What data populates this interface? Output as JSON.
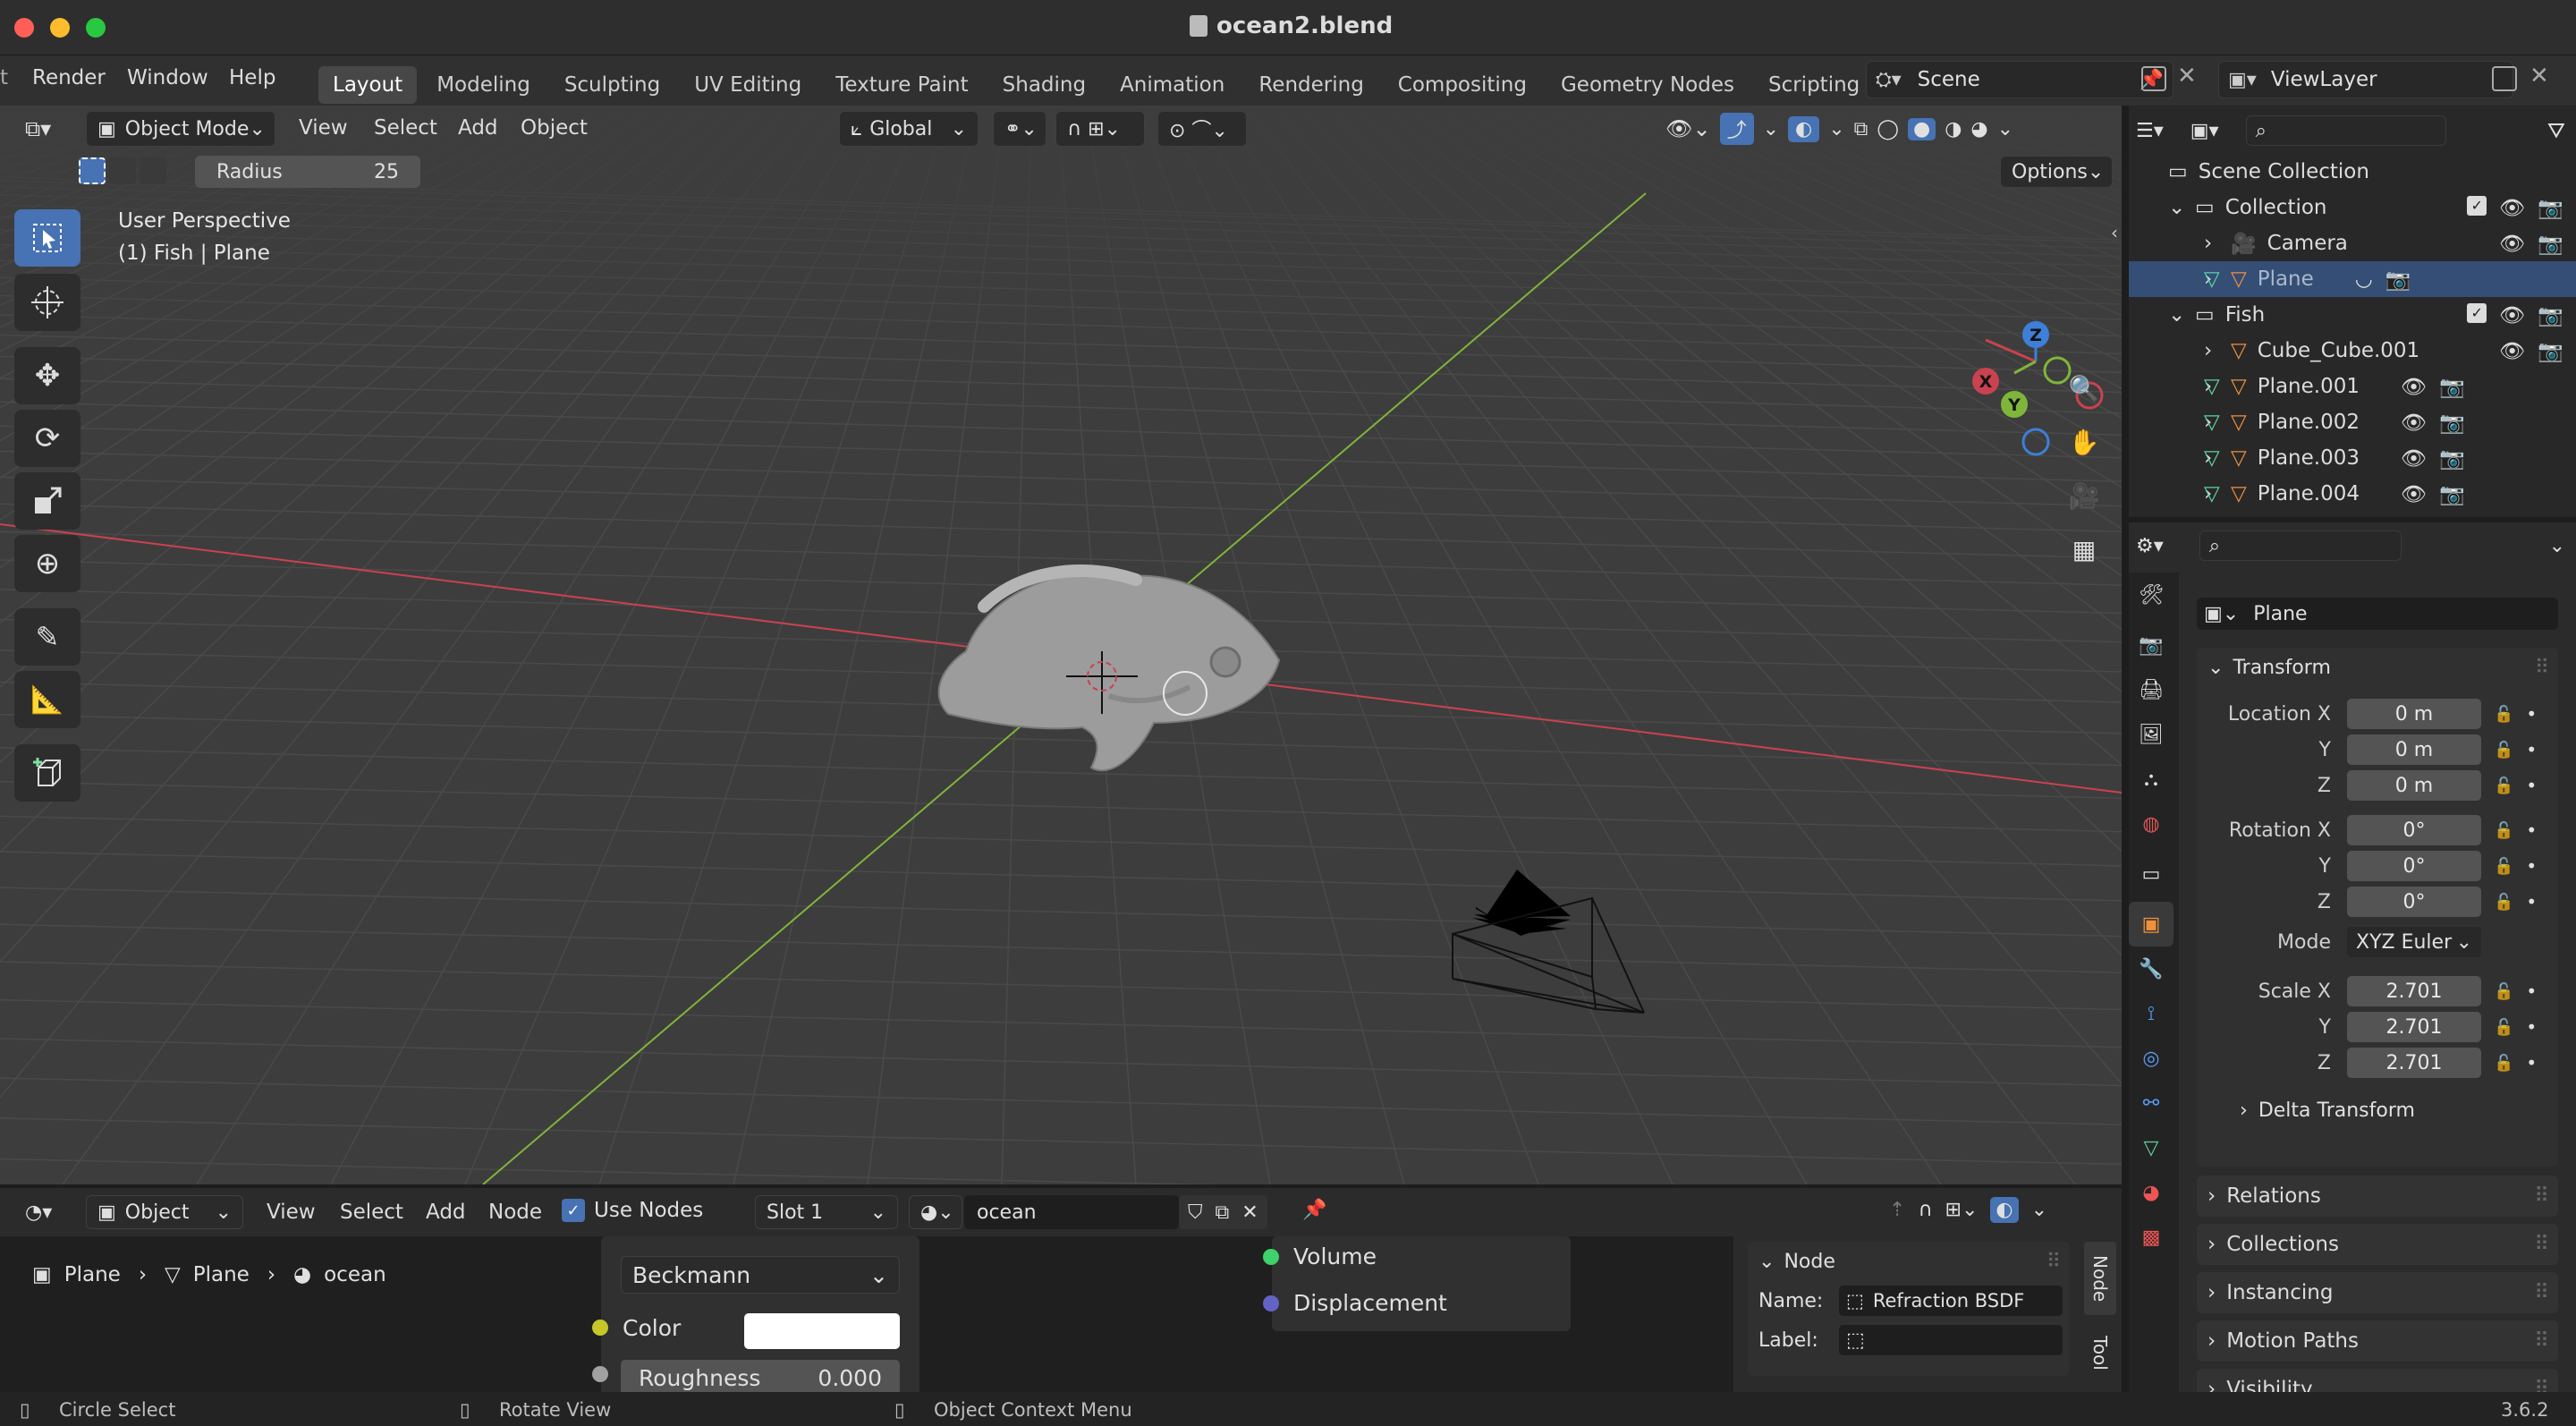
{
  "window": {
    "title": "ocean2.blend"
  },
  "menu": {
    "items": [
      "Render",
      "Window",
      "Help"
    ]
  },
  "workspaces": [
    "Layout",
    "Modeling",
    "Sculpting",
    "UV Editing",
    "Texture Paint",
    "Shading",
    "Animation",
    "Rendering",
    "Compositing",
    "Geometry Nodes",
    "Scripting"
  ],
  "scene": {
    "name": "Scene",
    "view_layer": "ViewLayer"
  },
  "viewport": {
    "mode": "Object Mode",
    "menus": [
      "View",
      "Select",
      "Add",
      "Object"
    ],
    "transform_orientation": "Global",
    "radius_label": "Radius",
    "radius_value": "25",
    "options_label": "Options",
    "overlay_title": "User Perspective",
    "overlay_subtitle": "(1) Fish | Plane",
    "gizmo": {
      "x": "X",
      "y": "Y",
      "z": "Z"
    }
  },
  "outliner": {
    "root": "Scene Collection",
    "rows": [
      {
        "label": "Collection",
        "depth": 1,
        "type": "collection",
        "expanded": true
      },
      {
        "label": "Camera",
        "depth": 2,
        "type": "camera"
      },
      {
        "label": "Plane",
        "depth": 2,
        "type": "mesh",
        "selected": true
      },
      {
        "label": "Fish",
        "depth": 1,
        "type": "collection",
        "expanded": true
      },
      {
        "label": "Cube_Cube.001",
        "depth": 2,
        "type": "mesh"
      },
      {
        "label": "Plane.001",
        "depth": 2,
        "type": "mesh"
      },
      {
        "label": "Plane.002",
        "depth": 2,
        "type": "mesh"
      },
      {
        "label": "Plane.003",
        "depth": 2,
        "type": "mesh"
      },
      {
        "label": "Plane.004",
        "depth": 2,
        "type": "mesh"
      }
    ]
  },
  "properties": {
    "object_name": "Plane",
    "transform_label": "Transform",
    "location_label": "Location X",
    "rotation_label": "Rotation X",
    "scale_label": "Scale X",
    "y_label": "Y",
    "z_label": "Z",
    "location": [
      "0 m",
      "0 m",
      "0 m"
    ],
    "rotation": [
      "0°",
      "0°",
      "0°"
    ],
    "mode_label": "Mode",
    "mode_value": "XYZ Euler",
    "scale": [
      "2.701",
      "2.701",
      "2.701"
    ],
    "delta_transform": "Delta Transform",
    "panels": [
      "Relations",
      "Collections",
      "Instancing",
      "Motion Paths",
      "Visibility"
    ]
  },
  "node_editor": {
    "type": "Object",
    "menus": [
      "View",
      "Select",
      "Add",
      "Node"
    ],
    "use_nodes_label": "Use Nodes",
    "slot": "Slot 1",
    "material": "ocean",
    "breadcrumb": [
      "Plane",
      "Plane",
      "ocean"
    ],
    "distribution": "Beckmann",
    "color_label": "Color",
    "roughness_label": "Roughness",
    "roughness_value": "0.000",
    "output_sockets": [
      "Volume",
      "Displacement"
    ],
    "sidebar": {
      "section": "Node",
      "name_label": "Name:",
      "name_value": "Refraction BSDF",
      "label_label": "Label:",
      "tab_node": "Node",
      "tab_tool": "Tool"
    }
  },
  "status": {
    "left": "Circle Select",
    "middle": "Rotate View",
    "right": "Object Context Menu",
    "version": "3.6.2"
  },
  "colors": {
    "accent": "#4772b3",
    "x_axis": "#c9424f",
    "y_axis": "#7fb53a",
    "z_axis": "#3d7fd9",
    "selected_row": "#344e75"
  }
}
